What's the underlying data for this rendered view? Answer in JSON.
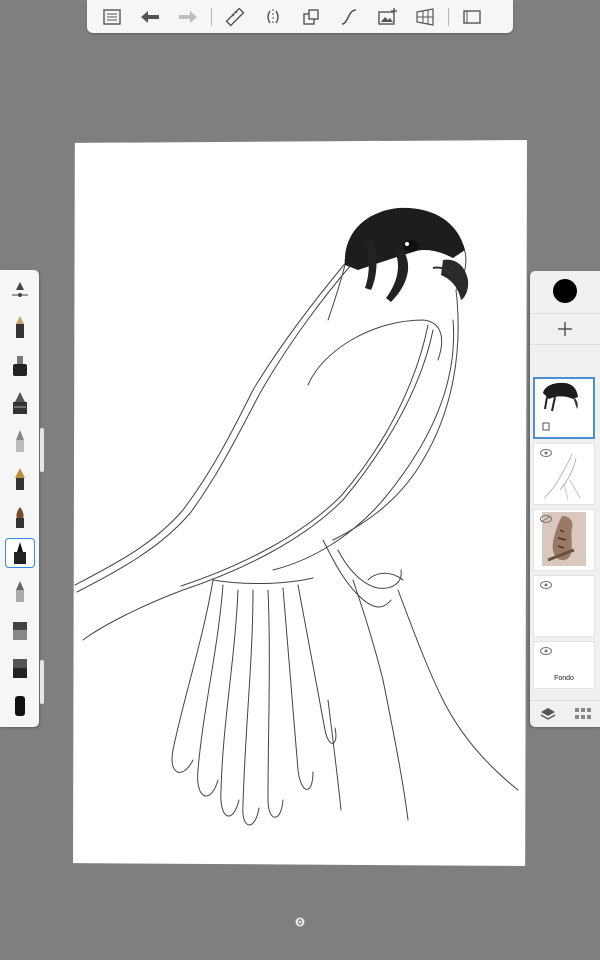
{
  "toolbar": {
    "items": [
      {
        "name": "menu-list-icon"
      },
      {
        "name": "undo-icon"
      },
      {
        "name": "redo-icon"
      },
      {
        "name": "ruler-icon"
      },
      {
        "name": "symmetry-icon"
      },
      {
        "name": "transform-icon"
      },
      {
        "name": "curve-icon"
      },
      {
        "name": "image-add-icon"
      },
      {
        "name": "perspective-grid-icon"
      },
      {
        "name": "fullscreen-icon"
      }
    ]
  },
  "brushes": [
    {
      "name": "brush-size-slider-icon"
    },
    {
      "name": "pencil-brush-icon"
    },
    {
      "name": "marker-brush-icon"
    },
    {
      "name": "airbrush-icon"
    },
    {
      "name": "ballpoint-pen-icon"
    },
    {
      "name": "fountain-pen-icon"
    },
    {
      "name": "paintbrush-icon"
    },
    {
      "name": "inking-pen-icon",
      "selected": true
    },
    {
      "name": "chisel-brush-icon"
    },
    {
      "name": "eraser-brush-icon"
    },
    {
      "name": "smudge-brush-icon"
    },
    {
      "name": "fill-brush-icon"
    }
  ],
  "layers": {
    "current_color": "#000000",
    "items": [
      {
        "name": "layer-falcon-head",
        "selected": true
      },
      {
        "name": "layer-sketch"
      },
      {
        "name": "layer-reference-photo"
      },
      {
        "name": "layer-empty"
      },
      {
        "name": "layer-background",
        "label": "Fondo"
      }
    ]
  },
  "colors": {
    "background": "#7f7f7f",
    "panel": "#f6f6f6",
    "accent": "#2f8ce0"
  }
}
